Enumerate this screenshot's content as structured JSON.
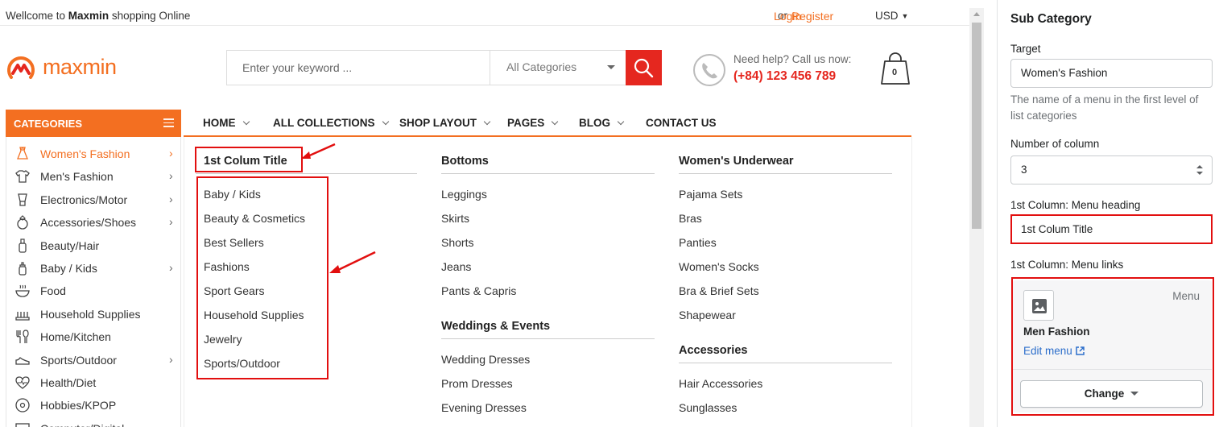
{
  "topbar": {
    "welcome_prefix": "Wellcome to",
    "welcome_brand": "Maxmin",
    "welcome_suffix": "shopping Online",
    "login": "Login",
    "or": "or",
    "register": "Register",
    "currency": "USD"
  },
  "logo": {
    "text": "maxmin"
  },
  "search": {
    "placeholder": "Enter your keyword ...",
    "category": "All Categories"
  },
  "help": {
    "line1": "Need help? Call us now:",
    "phone": "(+84) 123 456 789"
  },
  "cart": {
    "count": "0"
  },
  "categories": {
    "title": "CATEGORIES",
    "items": [
      {
        "label": "Women's Fashion",
        "icon": "dress-icon",
        "has_sub": true,
        "active": true
      },
      {
        "label": "Men's Fashion",
        "icon": "shirt-icon",
        "has_sub": true
      },
      {
        "label": "Electronics/Motor",
        "icon": "blender-icon",
        "has_sub": true
      },
      {
        "label": "Accessories/Shoes",
        "icon": "ring-icon",
        "has_sub": true
      },
      {
        "label": "Beauty/Hair",
        "icon": "bottle-icon",
        "has_sub": false
      },
      {
        "label": "Baby / Kids",
        "icon": "baby-bottle-icon",
        "has_sub": true
      },
      {
        "label": "Food",
        "icon": "bowl-icon",
        "has_sub": false
      },
      {
        "label": "Household Supplies",
        "icon": "tray-icon",
        "has_sub": false
      },
      {
        "label": "Home/Kitchen",
        "icon": "kitchen-utensils-icon",
        "has_sub": false
      },
      {
        "label": "Sports/Outdoor",
        "icon": "sneaker-icon",
        "has_sub": true
      },
      {
        "label": "Health/Diet",
        "icon": "heartbeat-icon",
        "has_sub": false
      },
      {
        "label": "Hobbies/KPOP",
        "icon": "disc-icon",
        "has_sub": false
      },
      {
        "label": "Computer/Digital",
        "icon": "monitor-icon",
        "has_sub": false
      }
    ]
  },
  "nav": [
    {
      "label": "HOME",
      "dropdown": true
    },
    {
      "label": "ALL COLLECTIONS",
      "dropdown": true
    },
    {
      "label": "SHOP LAYOUT",
      "dropdown": true
    },
    {
      "label": "PAGES",
      "dropdown": true
    },
    {
      "label": "BLOG",
      "dropdown": true
    },
    {
      "label": "CONTACT US",
      "dropdown": false
    }
  ],
  "mega": {
    "col1": {
      "heading": "1st Colum Title",
      "links": [
        "Baby / Kids",
        "Beauty & Cosmetics",
        "Best Sellers",
        "Fashions",
        "Sport Gears",
        "Household Supplies",
        "Jewelry",
        "Sports/Outdoor"
      ]
    },
    "col2": {
      "heading": "Bottoms",
      "links": [
        "Leggings",
        "Skirts",
        "Shorts",
        "Jeans",
        "Pants & Capris"
      ],
      "heading2": "Weddings & Events",
      "links2": [
        "Wedding Dresses",
        "Prom Dresses",
        "Evening Dresses"
      ]
    },
    "col3": {
      "heading": "Women's Underwear",
      "links": [
        "Pajama Sets",
        "Bras",
        "Panties",
        "Women's Socks",
        "Bra & Brief Sets",
        "Shapewear"
      ],
      "heading2": "Accessories",
      "links2": [
        "Hair Accessories",
        "Sunglasses"
      ]
    }
  },
  "panel": {
    "title": "Sub Category",
    "target_label": "Target",
    "target_value": "Women's Fashion",
    "target_help": "The name of a menu in the first level of list categories",
    "columns_label": "Number of column",
    "columns_value": "3",
    "heading_label": "1st Column: Menu heading",
    "heading_value": "1st Colum Title",
    "links_label": "1st Column: Menu links",
    "menu_card": {
      "tag": "Menu",
      "title": "Men Fashion",
      "edit": "Edit menu",
      "change": "Change"
    }
  },
  "colors": {
    "brand_orange": "#f36f21",
    "search_red": "#e5271f",
    "annotation_red": "#e20f0f",
    "link_blue": "#2c6ecb"
  }
}
